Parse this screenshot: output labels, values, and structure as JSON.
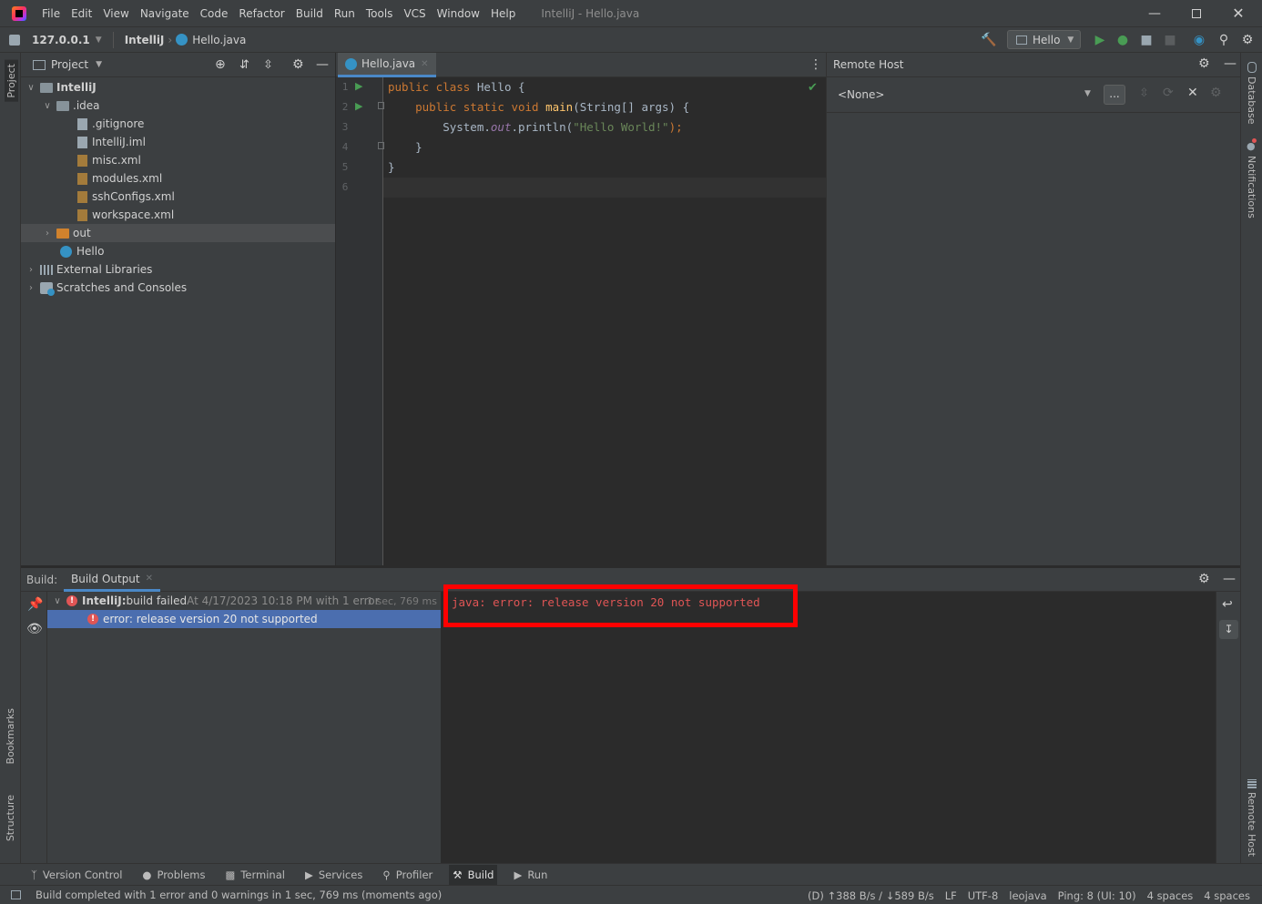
{
  "menu": {
    "items": [
      "File",
      "Edit",
      "View",
      "Navigate",
      "Code",
      "Refactor",
      "Build",
      "Run",
      "Tools",
      "VCS",
      "Window",
      "Help"
    ],
    "window_title": "IntelliJ - Hello.java"
  },
  "navbar": {
    "host": "127.0.0.1",
    "project": "IntelliJ",
    "file": "Hello.java",
    "run_config": "Hello"
  },
  "project_panel": {
    "title": "Project",
    "tree": [
      {
        "label": "IntelliJ"
      },
      {
        "label": ".idea"
      },
      {
        "label": ".gitignore"
      },
      {
        "label": "IntelliJ.iml"
      },
      {
        "label": "misc.xml"
      },
      {
        "label": "modules.xml"
      },
      {
        "label": "sshConfigs.xml"
      },
      {
        "label": "workspace.xml"
      },
      {
        "label": "out"
      },
      {
        "label": "Hello"
      },
      {
        "label": "External Libraries"
      },
      {
        "label": "Scratches and Consoles"
      }
    ]
  },
  "editor": {
    "tab": "Hello.java",
    "line_numbers": [
      "1",
      "2",
      "3",
      "4",
      "5",
      "6"
    ],
    "code": {
      "l1_kw": "public class ",
      "l1_rest": "Hello {",
      "l2_kw": "    public static void ",
      "l2_fn": "main",
      "l2_rest": "(String[] args) {",
      "l3_a": "        System.",
      "l3_out": "out",
      "l3_b": ".println(",
      "l3_str": "\"Hello World!\"",
      "l3_c": ");",
      "l4": "    }",
      "l5": "}"
    }
  },
  "remote_host": {
    "title": "Remote Host",
    "selected": "<None>",
    "browse_label": "..."
  },
  "build": {
    "label": "Build:",
    "tab": "Build Output",
    "root_name": "IntelliJ:",
    "root_status": " build failed",
    "root_detail": " At 4/17/2023 10:18 PM with 1 error",
    "root_time": "1 sec, 769 ms",
    "child": "error: release version 20 not supported",
    "output_line": "java: error: release version 20 not supported"
  },
  "left_stripe": {
    "project": "Project",
    "bookmarks": "Bookmarks",
    "structure": "Structure"
  },
  "right_stripe": {
    "database": "Database",
    "notifications": "Notifications",
    "remote_host": "Remote Host"
  },
  "tool_tabs": [
    "Version Control",
    "Problems",
    "Terminal",
    "Services",
    "Profiler",
    "Build",
    "Run"
  ],
  "status": {
    "message": "Build completed with 1 error and 0 warnings in 1 sec, 769 ms (moments ago)",
    "transfer": "(D) ↑388 B/s / ↓589 B/s",
    "line_sep": "LF",
    "encoding": "UTF-8",
    "user": "leojava",
    "ping": "Ping: 8 (UI: 10)",
    "indent1": "4 spaces",
    "indent2": "4 spaces"
  },
  "colors": {
    "accent": "#4a88c7",
    "error": "#e05555",
    "highlight_box": "#ff0000",
    "run_green": "#499c54"
  }
}
